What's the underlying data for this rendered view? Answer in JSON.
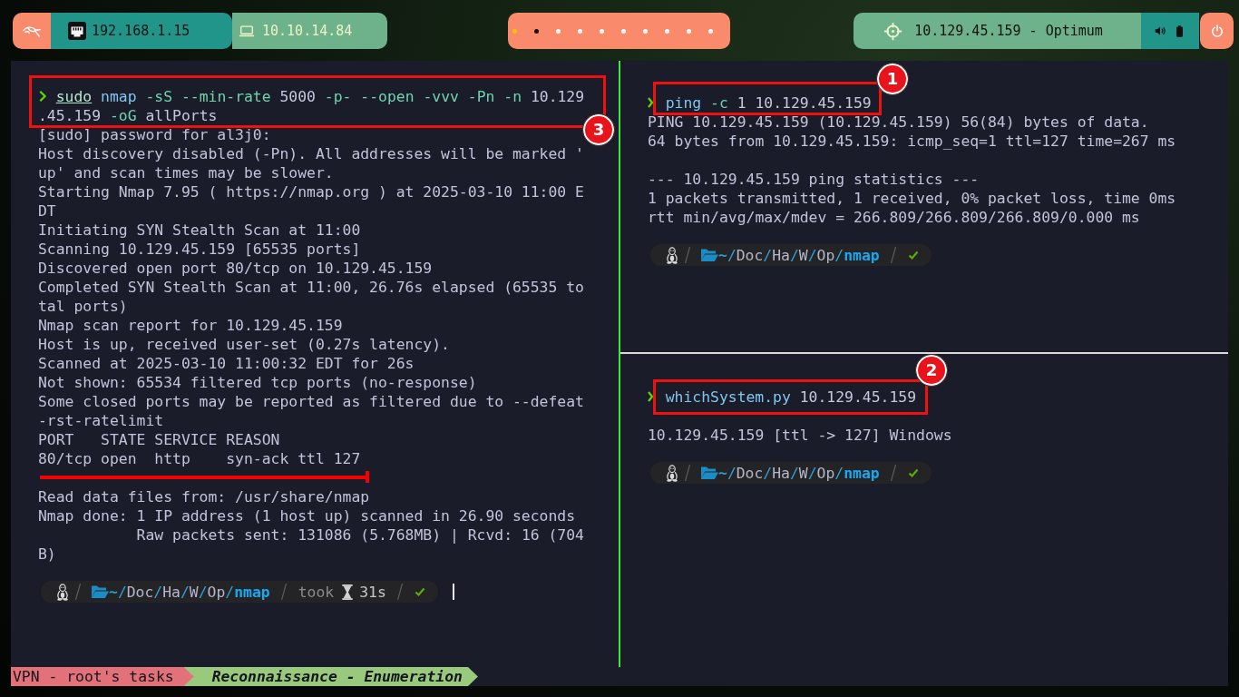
{
  "top_bar": {
    "ethernet_ip": "192.168.1.15",
    "vpn_ip": "10.10.14.84",
    "workspaces": [
      {
        "selected": true,
        "occupied": false
      },
      {
        "selected": false,
        "occupied": true
      },
      {
        "selected": false,
        "occupied": false
      },
      {
        "selected": false,
        "occupied": false
      },
      {
        "selected": false,
        "occupied": false
      },
      {
        "selected": false,
        "occupied": false
      },
      {
        "selected": false,
        "occupied": false
      },
      {
        "selected": false,
        "occupied": false
      },
      {
        "selected": false,
        "occupied": false
      },
      {
        "selected": false,
        "occupied": false
      }
    ],
    "target": "10.129.45.159 - Optimum"
  },
  "terminal": {
    "panes": [
      {
        "active": true,
        "command": {
          "lines": [
            [
              {
                "text": "sudo",
                "kind": "precommand"
              },
              {
                "text": "nmap",
                "kind": "command"
              },
              {
                "text": "-sS",
                "kind": "option"
              },
              {
                "text": "--min-rate",
                "kind": "option"
              },
              {
                "text": "5000",
                "kind": "argument"
              },
              {
                "text": "-p-",
                "kind": "option"
              },
              {
                "text": "--open",
                "kind": "option"
              },
              {
                "text": "-vvv",
                "kind": "option"
              },
              {
                "text": "-Pn",
                "kind": "option"
              },
              {
                "text": "-n",
                "kind": "option"
              },
              {
                "text": "10.129",
                "kind": "argument"
              }
            ],
            [
              {
                "text": ".45.159",
                "kind": "argument"
              },
              {
                "text": "-oG",
                "kind": "option"
              },
              {
                "text": "allPorts",
                "kind": "argument"
              }
            ]
          ],
          "badge": "3"
        },
        "output": [
          {
            "underlined": true,
            "lines": [
              "[sudo] password for al3j0:",
              "Host discovery disabled (-Pn). All addresses will be marked 'up' and scan times may be slower.",
              "Starting Nmap 7.95 ( https://nmap.org ) at 2025-03-10 11:00 EDT",
              "Initiating SYN Stealth Scan at 11:00",
              "Scanning 10.129.45.159 [65535 ports]",
              "Discovered open port 80/tcp on 10.129.45.159",
              "Completed SYN Stealth Scan at 11:00, 26.76s elapsed (65535 total ports)",
              "Nmap scan report for 10.129.45.159",
              "Host is up, received user-set (0.27s latency).",
              "Scanned at 2025-03-10 11:00:32 EDT for 26s",
              "Not shown: 65534 filtered tcp ports (no-response)",
              "Some closed ports may be reported as filtered due to --defeat-rst-ratelimit",
              "PORT   STATE SERVICE REASON",
              "80/tcp open  http    syn-ack ttl 127"
            ]
          },
          {
            "underlined": false,
            "lines": [
              "Read data files from: /usr/share/nmap",
              "Nmap done: 1 IP address (1 host up) scanned in 26.90 seconds",
              "           Raw packets sent: 131086 (5.768MB) | Rcvd: 16 (704B)"
            ]
          }
        ],
        "prompt": {
          "path": "~/Doc/Ha/W/Op/nmap",
          "duration_label": "took",
          "duration": "31s",
          "success": true,
          "cursor": true
        }
      },
      {
        "active": false,
        "command": {
          "lines": [
            [
              {
                "text": "ping",
                "kind": "command"
              },
              {
                "text": "-c",
                "kind": "option"
              },
              {
                "text": "1",
                "kind": "argument"
              },
              {
                "text": "10.129.45.159",
                "kind": "argument"
              }
            ]
          ],
          "badge": "1"
        },
        "output": [
          {
            "underlined": false,
            "lines": [
              "PING 10.129.45.159 (10.129.45.159) 56(84) bytes of data.",
              "64 bytes from 10.129.45.159: icmp_seq=1 ttl=127 time=267 ms"
            ]
          },
          {
            "underlined": false,
            "lines": [
              "--- 10.129.45.159 ping statistics ---",
              "1 packets transmitted, 1 received, 0% packet loss, time 0ms",
              "rtt min/avg/max/mdev = 266.809/266.809/266.809/0.000 ms"
            ]
          }
        ],
        "prompt": {
          "path": "~/Doc/Ha/W/Op/nmap",
          "success": true,
          "cursor": false
        }
      },
      {
        "active": false,
        "command": {
          "lines": [
            [
              {
                "text": "whichSystem.py",
                "kind": "command"
              },
              {
                "text": "10.129.45.159",
                "kind": "argument"
              }
            ]
          ],
          "badge": "2"
        },
        "output": [
          {
            "underlined": false,
            "lines": [
              "10.129.45.159 [ttl -> 127] Windows"
            ]
          }
        ],
        "prompt": {
          "path": "~/Doc/Ha/W/Op/nmap",
          "success": true,
          "cursor": false
        }
      }
    ],
    "status_bar": {
      "session": "VPN - root's tasks",
      "windows": [
        {
          "name": "Reconnaissance - Enumeration",
          "selected": true
        }
      ]
    }
  }
}
